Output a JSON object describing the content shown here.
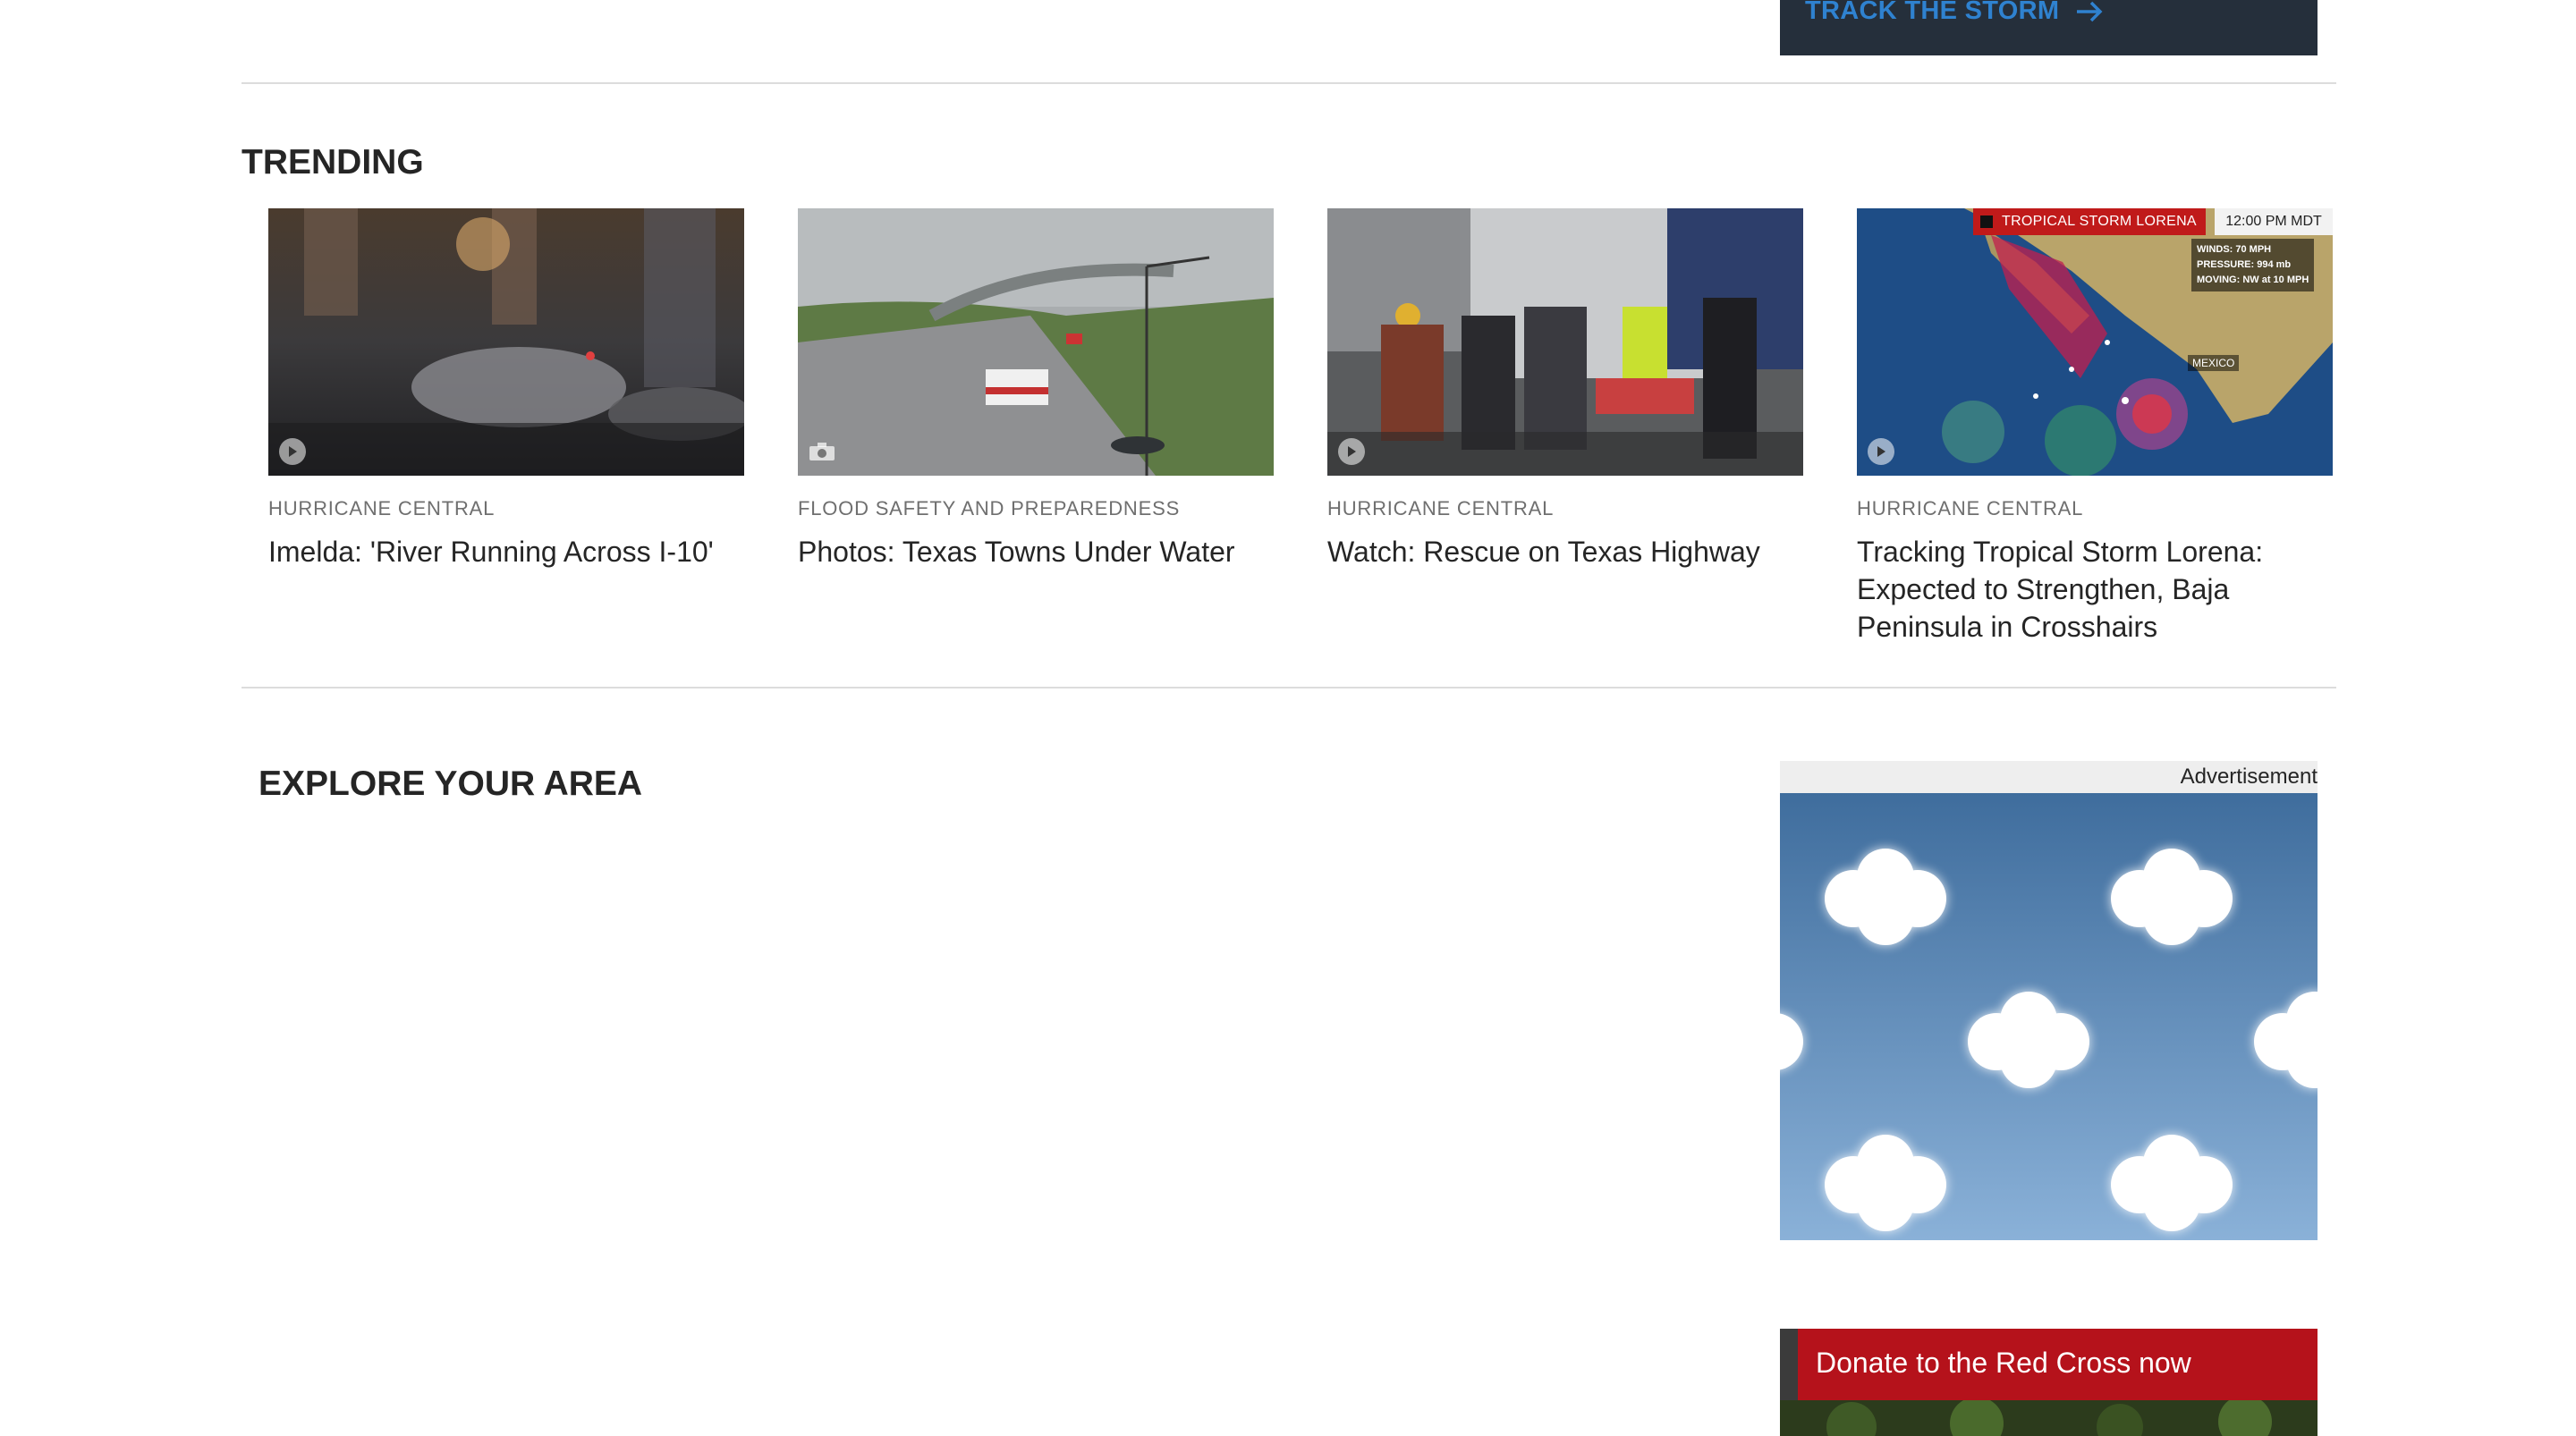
{
  "storm_banner": {
    "link_text": "TRACK THE STORM",
    "arrow_icon": "arrow-right-icon"
  },
  "trending": {
    "title": "TRENDING",
    "cards": [
      {
        "category": "HURRICANE CENTRAL",
        "headline": "Imelda: 'River Running Across I-10'",
        "media": "video-play-icon"
      },
      {
        "category": "FLOOD SAFETY AND PREPAREDNESS",
        "headline": "Photos: Texas Towns Under Water",
        "media": "camera-icon"
      },
      {
        "category": "HURRICANE CENTRAL",
        "headline": "Watch: Rescue on Texas Highway",
        "media": "video-play-icon"
      },
      {
        "category": "HURRICANE CENTRAL",
        "headline": "Tracking Tropical Storm Lorena: Expected to Strengthen, Baja Peninsula in Crosshairs",
        "media": "video-play-icon"
      }
    ],
    "map_overlay": {
      "storm_label": "TROPICAL STORM LORENA",
      "time": "12:00 PM MDT",
      "winds": "WINDS: 70 MPH",
      "pressure": "PRESSURE: 994 mb",
      "moving": "MOVING: NW at 10 MPH",
      "country": "MEXICO"
    }
  },
  "explore": {
    "title": "EXPLORE YOUR AREA"
  },
  "advertisement": {
    "label": "Advertisement"
  },
  "donate": {
    "text": "Donate to the Red Cross now"
  },
  "colors": {
    "banner_bg": "#252f3b",
    "link_blue": "#2f82d0",
    "donate_red": "#b5121b"
  }
}
